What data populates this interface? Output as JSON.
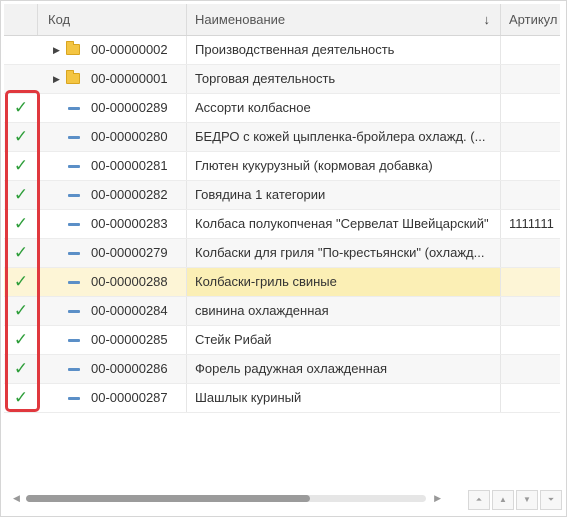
{
  "header": {
    "col_code": "Код",
    "col_name": "Наименование",
    "col_article": "Артикул",
    "sort_indicator": "↓"
  },
  "rows": [
    {
      "type": "folder",
      "code": "00-00000002",
      "name": "Производственная деятельность",
      "article": "",
      "checked": false
    },
    {
      "type": "folder",
      "code": "00-00000001",
      "name": "Торговая деятельность",
      "article": "",
      "checked": false
    },
    {
      "type": "item",
      "code": "00-00000289",
      "name": "Ассорти колбасное",
      "article": "",
      "checked": true
    },
    {
      "type": "item",
      "code": "00-00000280",
      "name": "БЕДРО с кожей цыпленка-бройлера охлажд. (...",
      "article": "",
      "checked": true
    },
    {
      "type": "item",
      "code": "00-00000281",
      "name": "Глютен кукурузный (кормовая добавка)",
      "article": "",
      "checked": true
    },
    {
      "type": "item",
      "code": "00-00000282",
      "name": "Говядина 1 категории",
      "article": "",
      "checked": true
    },
    {
      "type": "item",
      "code": "00-00000283",
      "name": "Колбаса полукопченая \"Сервелат Швейцарский\"",
      "article": "1111111",
      "checked": true
    },
    {
      "type": "item",
      "code": "00-00000279",
      "name": "Колбаски для гриля \"По-крестьянски\" (охлажд...",
      "article": "",
      "checked": true
    },
    {
      "type": "item",
      "code": "00-00000288",
      "name": "Колбаски-гриль свиные",
      "article": "",
      "checked": true,
      "selected": true
    },
    {
      "type": "item",
      "code": "00-00000284",
      "name": "свинина охлажденная",
      "article": "",
      "checked": true
    },
    {
      "type": "item",
      "code": "00-00000285",
      "name": "Стейк Рибай",
      "article": "",
      "checked": true
    },
    {
      "type": "item",
      "code": "00-00000286",
      "name": "Форель радужная охлажденная",
      "article": "",
      "checked": true
    },
    {
      "type": "item",
      "code": "00-00000287",
      "name": "Шашлык куриный",
      "article": "",
      "checked": true
    }
  ],
  "icons": {
    "check": "✓",
    "expander": "▶",
    "scroll_left": "◀",
    "scroll_right": "▶",
    "nav_first": "⏶",
    "nav_up": "▲",
    "nav_down": "▼",
    "nav_last": "⏷"
  },
  "colors": {
    "check": "#2e9e3a",
    "highlight_box": "#e0383e",
    "selected_row": "#fbefb5",
    "folder": "#f4c542",
    "item_icon": "#5b8fc7"
  },
  "scroll": {
    "horizontal_position": 0.0,
    "visible_fraction": 0.71
  }
}
